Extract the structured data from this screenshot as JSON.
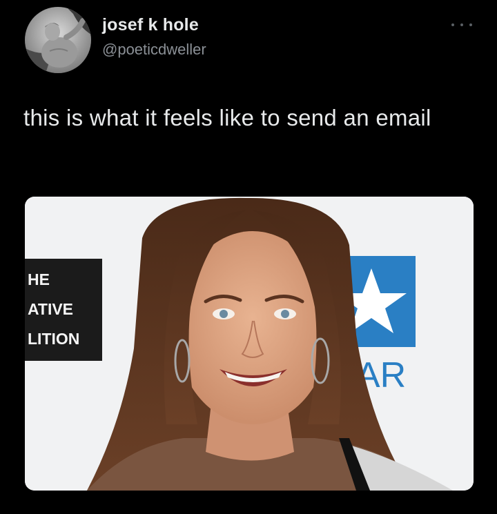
{
  "tweet": {
    "author": {
      "display_name": "josef k hole",
      "handle": "@poeticdweller",
      "avatar_icon": "avatar-photo"
    },
    "more_icon": "ellipsis-icon",
    "text": "this is what it feels like to send an email",
    "media": {
      "backdrop_left_lines": [
        "HE",
        "ATIVE",
        "LITION"
      ],
      "backdrop_right_text": "TAR"
    }
  },
  "colors": {
    "background": "#000000",
    "primary_text": "#e7e9ea",
    "secondary_text": "#8b9096",
    "logo_blue": "#2a7fc4"
  }
}
